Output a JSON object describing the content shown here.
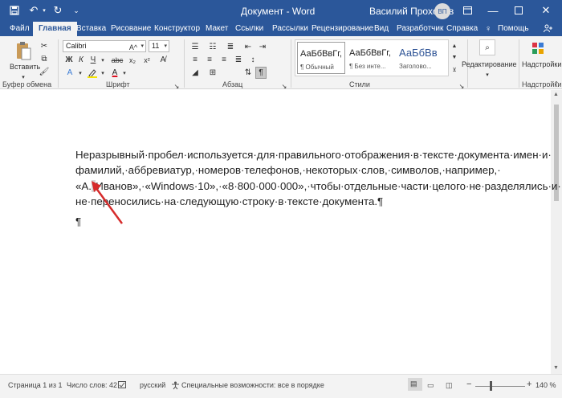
{
  "titlebar": {
    "doc_title": "Документ - Word",
    "user_name": "Василий Прохоров",
    "user_initials": "ВП"
  },
  "tabs": [
    {
      "label": "Файл"
    },
    {
      "label": "Главная"
    },
    {
      "label": "Вставка"
    },
    {
      "label": "Рисование"
    },
    {
      "label": "Конструктор"
    },
    {
      "label": "Макет"
    },
    {
      "label": "Ссылки"
    },
    {
      "label": "Рассылки"
    },
    {
      "label": "Рецензирование"
    },
    {
      "label": "Вид"
    },
    {
      "label": "Разработчик"
    },
    {
      "label": "Справка"
    },
    {
      "label": "Помощь"
    }
  ],
  "ribbon": {
    "clipboard": {
      "paste_label": "Вставить",
      "group_label": "Буфер обмена"
    },
    "font": {
      "font_name": "Calibri",
      "font_size": "11",
      "group_label": "Шрифт"
    },
    "paragraph": {
      "group_label": "Абзац"
    },
    "styles": {
      "group_label": "Стили",
      "items": [
        {
          "preview": "АаБбВвГг,",
          "name": "¶ Обычный"
        },
        {
          "preview": "АаБбВвГг,",
          "name": "¶ Без инте..."
        },
        {
          "preview": "АаБбВв",
          "name": "Заголово..."
        }
      ]
    },
    "editing": {
      "label": "Редактирование"
    },
    "addins": {
      "label": "Надстройки",
      "group_label": "Надстройки"
    }
  },
  "document": {
    "lines": [
      "Неразрывный·пробел·используется·для·правильного·отображения·в·тексте·документа·имен·и·",
      "фамилий,·аббревиатур,·номеров·телефонов,·некоторых·слов,·символов,·например,·",
      "«А.",
      "Иванов»,·«Windows·10»,·«8·800·000·000»,·чтобы·отдельные·части·целого·не·разделялись·и·",
      "не·переносились·на·следующую·строку·в·тексте·документа.¶"
    ],
    "empty_paragraph": "¶"
  },
  "statusbar": {
    "page": "Страница 1 из 1",
    "words": "Число слов: 42",
    "language": "русский",
    "accessibility": "Специальные возможности: все в порядке",
    "zoom": "140 %"
  }
}
